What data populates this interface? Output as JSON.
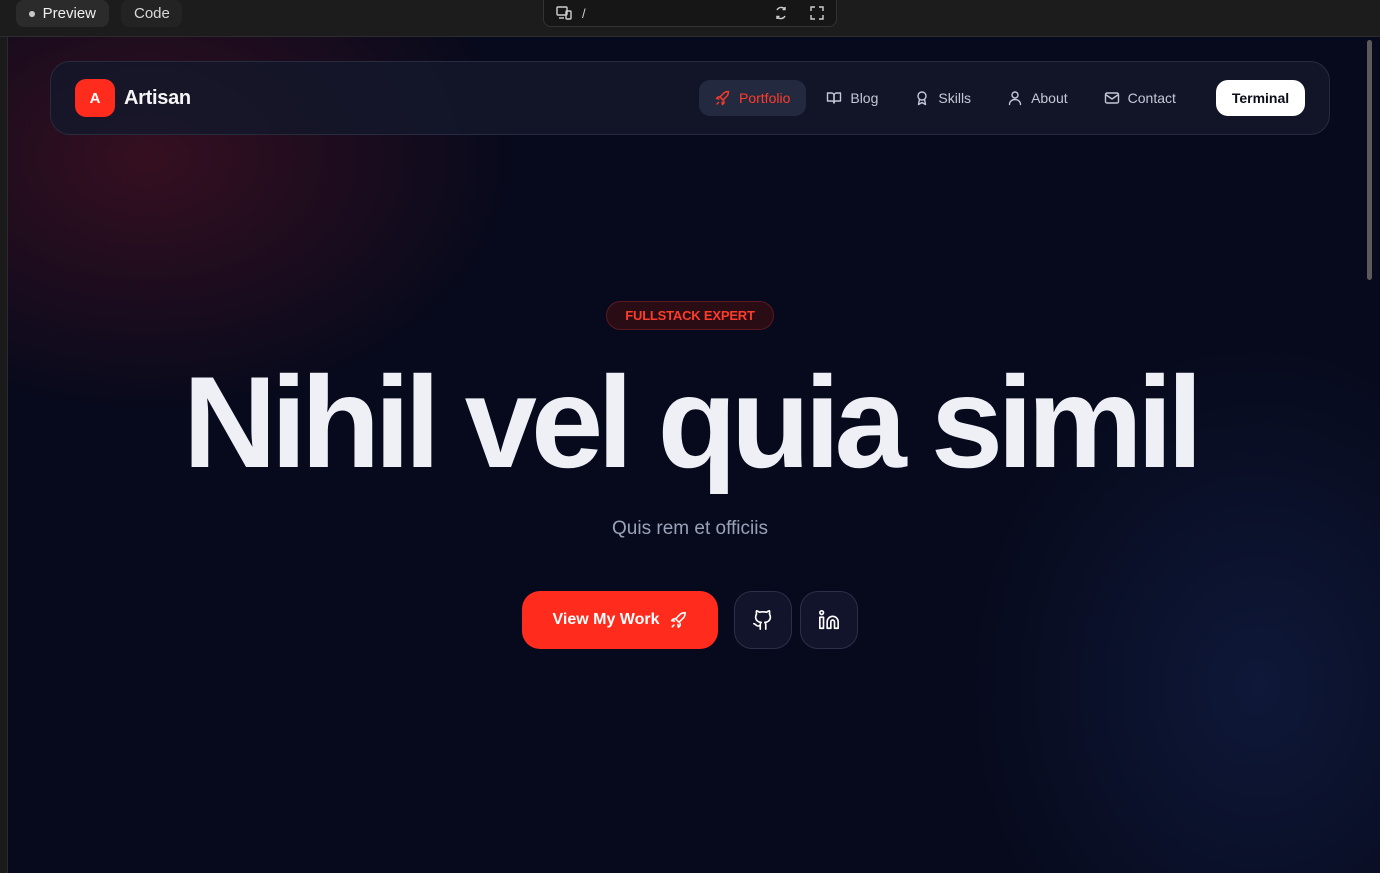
{
  "editor": {
    "tabs": [
      {
        "label": "Preview"
      },
      {
        "label": "Code"
      }
    ],
    "url_path": "/"
  },
  "nav": {
    "brand_mark": "A",
    "brand_name": "Artisan",
    "links": [
      {
        "label": "Portfolio",
        "icon": "rocket-icon"
      },
      {
        "label": "Blog",
        "icon": "book-icon"
      },
      {
        "label": "Skills",
        "icon": "award-icon"
      },
      {
        "label": "About",
        "icon": "user-icon"
      },
      {
        "label": "Contact",
        "icon": "mail-icon"
      }
    ],
    "terminal_label": "Terminal"
  },
  "hero": {
    "badge": "FULLSTACK EXPERT",
    "title": "Nihil vel quia simil",
    "subtitle": "Quis rem et officiis",
    "cta_label": "View My Work",
    "social": [
      {
        "name": "github-icon"
      },
      {
        "name": "linkedin-icon"
      }
    ]
  },
  "colors": {
    "accent": "#ff2b1c",
    "background": "#070a1c",
    "text": "#eef0f6"
  }
}
